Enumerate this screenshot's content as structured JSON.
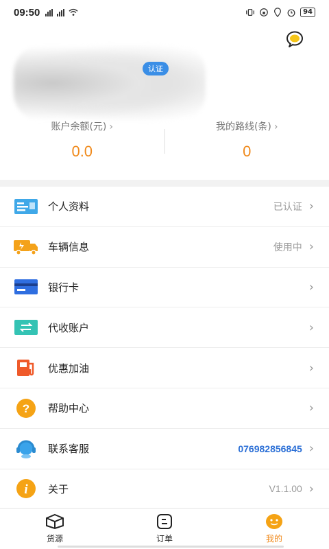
{
  "status_bar": {
    "time": "09:50",
    "battery": "94"
  },
  "header": {
    "verify_badge": "认证"
  },
  "stats": [
    {
      "label": "账户余额(元)",
      "value": "0.0"
    },
    {
      "label": "我的路线(条)",
      "value": "0"
    }
  ],
  "menu": [
    {
      "label": "个人资料",
      "value": "已认证",
      "icon": "id-card-icon"
    },
    {
      "label": "车辆信息",
      "value": "使用中",
      "icon": "truck-icon"
    },
    {
      "label": "银行卡",
      "value": "",
      "icon": "bank-card-icon"
    },
    {
      "label": "代收账户",
      "value": "",
      "icon": "transfer-icon"
    },
    {
      "label": "优惠加油",
      "value": "",
      "icon": "fuel-pump-icon"
    },
    {
      "label": "帮助中心",
      "value": "",
      "icon": "help-icon"
    },
    {
      "label": "联系客服",
      "value": "07698285684­5",
      "icon": "headset-icon"
    },
    {
      "label": "关于",
      "value": "V1.1.00",
      "icon": "info-icon"
    }
  ],
  "tabs": [
    {
      "label": "货源",
      "icon": "cube-icon",
      "active": false
    },
    {
      "label": "订单",
      "icon": "order-icon",
      "active": false
    },
    {
      "label": "我的",
      "icon": "profile-face-icon",
      "active": true
    }
  ],
  "colors": {
    "accent": "#f08a1c",
    "link_blue": "#2b6fd6"
  }
}
